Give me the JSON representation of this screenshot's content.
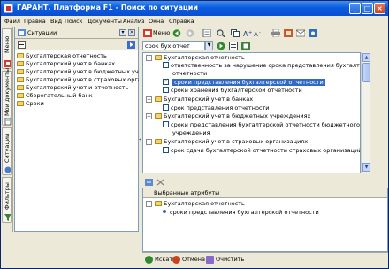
{
  "window": {
    "title": "ГАРАНТ. Платформа F1 - Поиск по ситуации",
    "controls": [
      "_",
      "□",
      "×"
    ]
  },
  "menubar": [
    "Файл",
    "Правка",
    "Вид",
    "Поиск",
    "Документы",
    "Анализ",
    "Окна",
    "Справка"
  ],
  "left_tabs": [
    "Меню",
    "Мои документы",
    "Ситуации",
    "Фильтры"
  ],
  "left_panel": {
    "header": "Ситуации",
    "items": [
      "Бухгалтерская отчетность",
      "Бухгалтерский учет в банках",
      "Бухгалтерский учет в бюджетных учр",
      "Бухгалтерский учет в страховых орга",
      "Бухгалтерский учет и отчетность",
      "Сберегательный банк",
      "Сроки"
    ]
  },
  "toolbar": {
    "menu_label": "Меню"
  },
  "search": {
    "value": "срок бух отчет"
  },
  "results": {
    "rows": [
      {
        "level": 0,
        "type": "group",
        "text": "Бухгалтерская отчетность"
      },
      {
        "level": 1,
        "type": "item",
        "text": "ответственность за нарушение срока представления бухгалтерской"
      },
      {
        "level": 1,
        "type": "cont",
        "text": "отчетности"
      },
      {
        "level": 1,
        "type": "item",
        "text": "сроки представления бухгалтерской отчетности",
        "checked": true,
        "selected": true
      },
      {
        "level": 1,
        "type": "item",
        "text": "сроки хранения бухгалтерской отчетности"
      },
      {
        "level": 0,
        "type": "group",
        "text": "Бухгалтерский учет в банках"
      },
      {
        "level": 1,
        "type": "item",
        "text": "срок представления отчетности"
      },
      {
        "level": 0,
        "type": "group",
        "text": "Бухгалтерский учет в бюджетных учреждениях"
      },
      {
        "level": 1,
        "type": "item",
        "text": "сроки представления бухгалтерской отчетности бюджетного"
      },
      {
        "level": 1,
        "type": "cont",
        "text": "учреждения"
      },
      {
        "level": 0,
        "type": "group",
        "text": "Бухгалтерский учет в страховых организациях"
      },
      {
        "level": 1,
        "type": "item",
        "text": "срок сдачи бухгалтерской отчетности страховых организаций"
      }
    ]
  },
  "attributes": {
    "header": "Выбранные атрибуты",
    "group": "Бухгалтерская отчетность",
    "item": "сроки представления бухгалтерской отчетности"
  },
  "buttons": {
    "search": "Искать",
    "cancel": "Отмена",
    "clear": "Очистить"
  },
  "colors": {
    "titlebar": "#0b5be0",
    "selection": "#316ac5",
    "panel": "#ece9d8"
  }
}
